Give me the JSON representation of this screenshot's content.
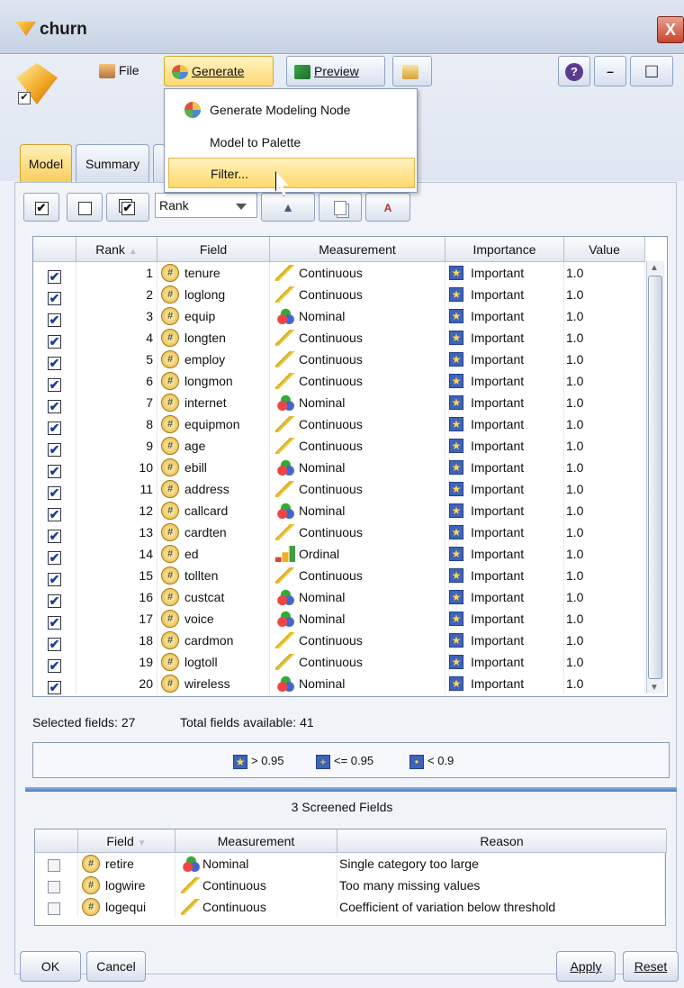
{
  "window": {
    "title": "churn",
    "close": "X"
  },
  "toolbar": {
    "file": "File",
    "generate": "Generate",
    "preview": "Preview",
    "help": "?",
    "minimize": "–",
    "maximize": "□"
  },
  "generate_menu": {
    "items": [
      "Generate Modeling Node",
      "Model to Palette",
      "Filter..."
    ]
  },
  "tabs": [
    "Model",
    "Summary"
  ],
  "select_buttons": {
    "check": "✔",
    "uncheck": "",
    "invert": "✔"
  },
  "sort": {
    "selected": "Rank",
    "az_mark": "A"
  },
  "fields_table": {
    "headers": [
      "",
      "Rank",
      "Field",
      "Measurement",
      "Importance",
      "Value"
    ],
    "rows": [
      {
        "checked": "✔",
        "rank": "1",
        "field": "tenure",
        "measurement": "Continuous",
        "importance": "Important",
        "value": "1.0"
      },
      {
        "checked": "✔",
        "rank": "2",
        "field": "loglong",
        "measurement": "Continuous",
        "importance": "Important",
        "value": "1.0"
      },
      {
        "checked": "✔",
        "rank": "3",
        "field": "equip",
        "measurement": "Nominal",
        "importance": "Important",
        "value": "1.0"
      },
      {
        "checked": "✔",
        "rank": "4",
        "field": "longten",
        "measurement": "Continuous",
        "importance": "Important",
        "value": "1.0"
      },
      {
        "checked": "✔",
        "rank": "5",
        "field": "employ",
        "measurement": "Continuous",
        "importance": "Important",
        "value": "1.0"
      },
      {
        "checked": "✔",
        "rank": "6",
        "field": "longmon",
        "measurement": "Continuous",
        "importance": "Important",
        "value": "1.0"
      },
      {
        "checked": "✔",
        "rank": "7",
        "field": "internet",
        "measurement": "Nominal",
        "importance": "Important",
        "value": "1.0"
      },
      {
        "checked": "✔",
        "rank": "8",
        "field": "equipmon",
        "measurement": "Continuous",
        "importance": "Important",
        "value": "1.0"
      },
      {
        "checked": "✔",
        "rank": "9",
        "field": "age",
        "measurement": "Continuous",
        "importance": "Important",
        "value": "1.0"
      },
      {
        "checked": "✔",
        "rank": "10",
        "field": "ebill",
        "measurement": "Nominal",
        "importance": "Important",
        "value": "1.0"
      },
      {
        "checked": "✔",
        "rank": "11",
        "field": "address",
        "measurement": "Continuous",
        "importance": "Important",
        "value": "1.0"
      },
      {
        "checked": "✔",
        "rank": "12",
        "field": "callcard",
        "measurement": "Nominal",
        "importance": "Important",
        "value": "1.0"
      },
      {
        "checked": "✔",
        "rank": "13",
        "field": "cardten",
        "measurement": "Continuous",
        "importance": "Important",
        "value": "1.0"
      },
      {
        "checked": "✔",
        "rank": "14",
        "field": "ed",
        "measurement": "Ordinal",
        "importance": "Important",
        "value": "1.0"
      },
      {
        "checked": "✔",
        "rank": "15",
        "field": "tollten",
        "measurement": "Continuous",
        "importance": "Important",
        "value": "1.0"
      },
      {
        "checked": "✔",
        "rank": "16",
        "field": "custcat",
        "measurement": "Nominal",
        "importance": "Important",
        "value": "1.0"
      },
      {
        "checked": "✔",
        "rank": "17",
        "field": "voice",
        "measurement": "Nominal",
        "importance": "Important",
        "value": "1.0"
      },
      {
        "checked": "✔",
        "rank": "18",
        "field": "cardmon",
        "measurement": "Continuous",
        "importance": "Important",
        "value": "1.0"
      },
      {
        "checked": "✔",
        "rank": "19",
        "field": "logtoll",
        "measurement": "Continuous",
        "importance": "Important",
        "value": "1.0"
      },
      {
        "checked": "✔",
        "rank": "20",
        "field": "wireless",
        "measurement": "Nominal",
        "importance": "Important",
        "value": "1.0"
      }
    ]
  },
  "field_icon_glyph": "#",
  "importance_glyph": "★",
  "selection_info": {
    "selected": "Selected fields: 27",
    "total": "Total fields available: 41"
  },
  "legend": [
    {
      "glyph": "★",
      "label": "> 0.95"
    },
    {
      "glyph": "+",
      "label": "<= 0.95"
    },
    {
      "glyph": "•",
      "label": "< 0.9"
    }
  ],
  "screened": {
    "title": "3 Screened Fields",
    "headers": [
      "",
      "Field",
      "Measurement",
      "Reason"
    ],
    "rows": [
      {
        "field": "retire",
        "measurement": "Nominal",
        "reason": "Single category too large"
      },
      {
        "field": "logwire",
        "measurement": "Continuous",
        "reason": "Too many missing values"
      },
      {
        "field": "logequi",
        "measurement": "Continuous",
        "reason": "Coefficient of variation below threshold"
      }
    ]
  },
  "buttons": {
    "ok": "OK",
    "cancel": "Cancel",
    "apply": "Apply",
    "reset": "Reset"
  }
}
